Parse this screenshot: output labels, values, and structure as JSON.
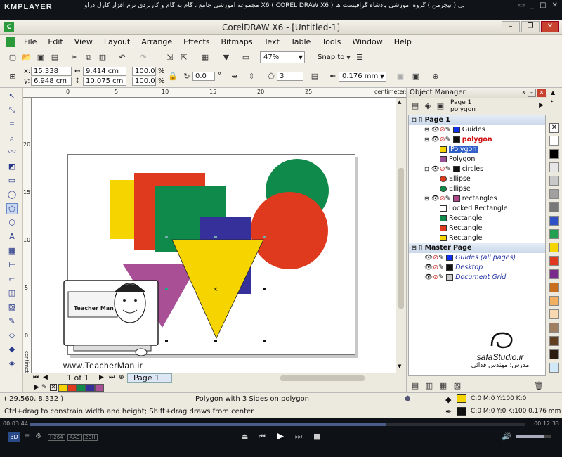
{
  "player": {
    "logo": "KMPLAYER",
    "title": "مجموعه آموزشی جامع ، گام به گام و کاربردی نرم افزار کارل دراو X6 ( COREL DRAW X6 ) مدرس : سعید فدایی ( تیچرمن ) گروه آموزشی پادشاه گرافیست ها",
    "time_elapsed": "00:03:44",
    "time_total": "00:12:33",
    "progress": 0.72,
    "badges": [
      "H264",
      "AAC",
      "2CH"
    ]
  },
  "app": {
    "title": "CorelDRAW X6 - [Untitled-1]",
    "menu": [
      "File",
      "Edit",
      "View",
      "Layout",
      "Arrange",
      "Effects",
      "Bitmaps",
      "Text",
      "Table",
      "Tools",
      "Window",
      "Help"
    ],
    "zoom": "47%",
    "snap_to": "Snap to"
  },
  "props": {
    "x": "15.338 cm",
    "y": "6.948 cm",
    "w": "9.414 cm",
    "h": "10.075 cm",
    "sx": "100.0",
    "sy": "100.0",
    "pct": "%",
    "angle": "0.0",
    "deg": "°",
    "sides": "3",
    "outline": "0.176 mm"
  },
  "ruler": {
    "top_ticks": [
      "0",
      "5",
      "10",
      "15",
      "20",
      "25"
    ],
    "top_unit": "centimeters",
    "left_ticks": [
      "20",
      "15",
      "10",
      "5",
      "0"
    ],
    "left_unit": "centimeters"
  },
  "canvas": {
    "watermark_url": "www.TeacherMan.ir",
    "badge_text": "Teacher Man",
    "studio": "safaStudio.ir",
    "studio_sub": "مدرس: مهندس فدائی"
  },
  "nav": {
    "page_counter": "1 of 1",
    "page_tab": "Page 1"
  },
  "objmgr": {
    "title": "Object Manager",
    "path_page": "Page 1",
    "path_obj": "polygon",
    "rows": [
      {
        "text": "Page 1",
        "type": "hdr"
      },
      {
        "text": "Guides",
        "type": "layer",
        "color": "#1030f0"
      },
      {
        "text": "polygon",
        "type": "layer-active",
        "color": "#111111"
      },
      {
        "text": "Polygon",
        "type": "obj-selected",
        "color": "#f5d400"
      },
      {
        "text": "Polygon",
        "type": "obj",
        "color": "#9b4f96"
      },
      {
        "text": "circles",
        "type": "layer",
        "color": "#111111"
      },
      {
        "text": "Ellipse",
        "type": "obj",
        "color": "#e03a1e"
      },
      {
        "text": "Ellipse",
        "type": "obj",
        "color": "#0f8a4a"
      },
      {
        "text": "rectangles",
        "type": "layer",
        "color": "#b0458c"
      },
      {
        "text": "Locked Rectangle",
        "type": "obj",
        "color": "#ffffff"
      },
      {
        "text": "Rectangle",
        "type": "obj",
        "color": "#0f8a4a"
      },
      {
        "text": "Rectangle",
        "type": "obj",
        "color": "#e03a1e"
      },
      {
        "text": "Rectangle",
        "type": "obj",
        "color": "#f5d400"
      },
      {
        "text": "Master Page",
        "type": "hdr"
      },
      {
        "text": "Guides (all pages)",
        "type": "master",
        "color": "#1030f0"
      },
      {
        "text": "Desktop",
        "type": "master",
        "color": "#111111"
      },
      {
        "text": "Document Grid",
        "type": "master",
        "color": "#cccccc"
      }
    ]
  },
  "shapes": {
    "yellow_rect": "#f5d400",
    "red_rect": "#e03a1e",
    "green_rect": "#0f8a4a",
    "blue_rect": "#35309a",
    "green_circle": "#0f8a4a",
    "red_circle": "#e03a1e",
    "purple_triangle": "#a84f96",
    "yellow_triangle": "#f5d400"
  },
  "status": {
    "coords": "( 29.560, 8.332 )",
    "info": "Polygon with 3 Sides on polygon",
    "hint": "Ctrl+drag to constrain width and height; Shift+drag draws from center",
    "fill": "C:0 M:0 Y:100 K:0",
    "outline": "C:0 M:0 Y:0 K:100  0.176 mm"
  },
  "palette_colors": [
    "#ffffff",
    "#000000",
    "#e6e6e6",
    "#c8c8c8",
    "#a0a0a0",
    "#787878",
    "#3050c8",
    "#20a050",
    "#f5d400",
    "#e03a1e",
    "#7a2a8a",
    "#c86e1e",
    "#f0b060",
    "#f8d8b0",
    "#a08060",
    "#604020",
    "#2c1c10",
    "#d0e8f8"
  ],
  "strip_colors": [
    "#f5d400",
    "#e03a1e",
    "#0f8a4a",
    "#35309a",
    "#a84f96"
  ]
}
